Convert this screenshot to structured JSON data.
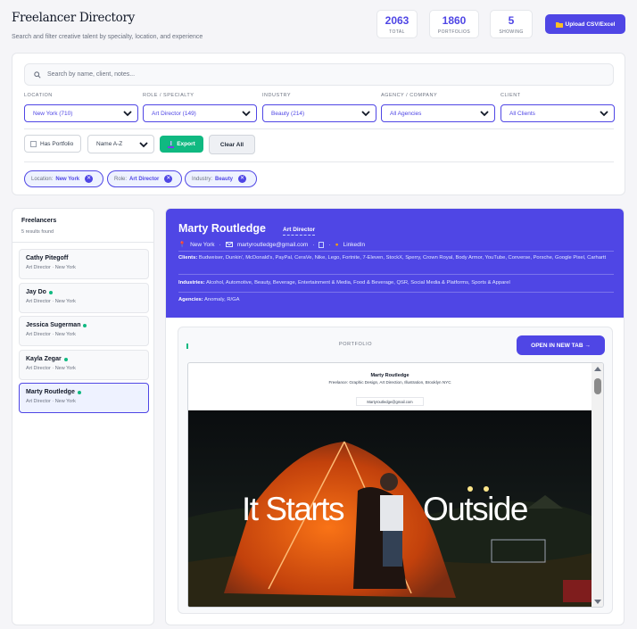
{
  "header": {
    "title": "Freelancer Directory",
    "subtitle": "Search and filter creative talent by specialty, location, and experience",
    "upload_label": "Upload CSV/Excel"
  },
  "stats": [
    {
      "value": "2063",
      "label": "TOTAL"
    },
    {
      "value": "1860",
      "label": "PORTFOLIOS"
    },
    {
      "value": "5",
      "label": "SHOWING"
    }
  ],
  "search": {
    "placeholder": "Search by name, client, notes..."
  },
  "filters": [
    {
      "label": "LOCATION",
      "value": "New York (710)"
    },
    {
      "label": "ROLE / SPECIALTY",
      "value": "Art Director (149)"
    },
    {
      "label": "INDUSTRY",
      "value": "Beauty (214)"
    },
    {
      "label": "AGENCY / COMPANY",
      "value": "All Agencies"
    },
    {
      "label": "CLIENT",
      "value": "All Clients"
    }
  ],
  "controls": {
    "has_portfolio": "Has Portfolio",
    "sort": "Name A-Z",
    "export": "Export",
    "clear": "Clear All"
  },
  "chips": [
    {
      "key": "Location:",
      "value": "New York"
    },
    {
      "key": "Role:",
      "value": "Art Director"
    },
    {
      "key": "Industry:",
      "value": "Beauty"
    }
  ],
  "list": {
    "title": "Freelancers",
    "count": "5 results found",
    "items": [
      {
        "name": "Cathy Pitegoff",
        "meta": "Art Director · New York"
      },
      {
        "name": "Jay Do",
        "meta": "Art Director · New York"
      },
      {
        "name": "Jessica Sugerman",
        "meta": "Art Director · New York"
      },
      {
        "name": "Kayla Zegar",
        "meta": "Art Director · New York"
      },
      {
        "name": "Marty Routledge",
        "meta": "Art Director · New York"
      }
    ]
  },
  "detail": {
    "name": "Marty Routledge",
    "role": "Art Director",
    "location": "New York",
    "email": "martyroutledge@gmail.com",
    "linkedin": "LinkedIn",
    "clients_label": "Clients:",
    "clients": "Budweiser, Dunkin', McDonald's, PayPal, CeraVe, Nike, Lego, Fortnite, 7-Eleven, StockX, Sperry, Crown Royal, Body Armor, YouTube, Converse, Porsche, Google Pixel, Carhartt",
    "industries_label": "Industries:",
    "industries": "Alcohol, Automotive, Beauty, Beverage, Entertainment & Media, Food & Beverage, QSR, Social Media & Platforms, Sports & Apparel",
    "agencies_label": "Agencies:",
    "agencies": "Anomaly, R/GA"
  },
  "portfolio": {
    "label": "PORTFOLIO",
    "open_label": "OPEN IN NEW TAB →",
    "site_name": "Marty Routledge",
    "site_desc": "Freelance: Graphic Design, Art Direction, Illustration, Brooklyn NYC",
    "site_email": "Martyroutledge@gmail.com",
    "hero_left": "It Starts",
    "hero_right": "Outside"
  },
  "colors": {
    "accent": "#4f46e5",
    "success": "#10b981"
  }
}
